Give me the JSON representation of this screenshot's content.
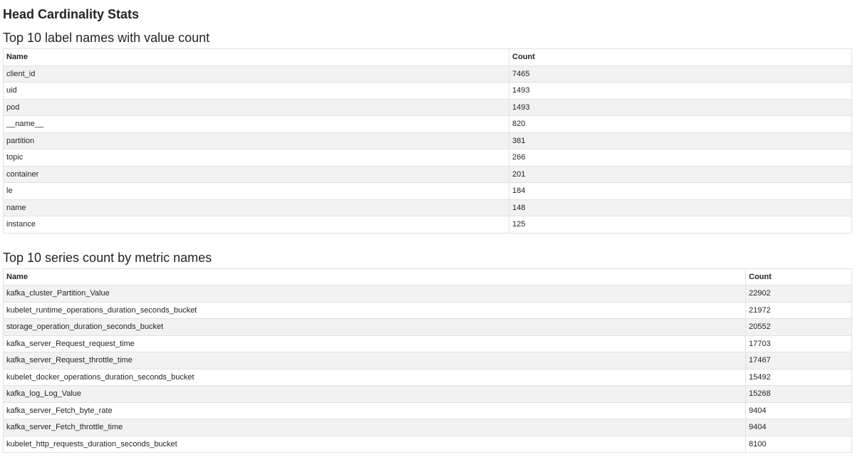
{
  "page": {
    "title": "Head Cardinality Stats"
  },
  "label_names": {
    "heading": "Top 10 label names with value count",
    "columns": [
      "Name",
      "Count"
    ],
    "rows": [
      {
        "name": "client_id",
        "count": "7465"
      },
      {
        "name": "uid",
        "count": "1493"
      },
      {
        "name": "pod",
        "count": "1493"
      },
      {
        "name": "__name__",
        "count": "820"
      },
      {
        "name": "partition",
        "count": "381"
      },
      {
        "name": "topic",
        "count": "266"
      },
      {
        "name": "container",
        "count": "201"
      },
      {
        "name": "le",
        "count": "184"
      },
      {
        "name": "name",
        "count": "148"
      },
      {
        "name": "instance",
        "count": "125"
      }
    ]
  },
  "metric_names": {
    "heading": "Top 10 series count by metric names",
    "columns": [
      "Name",
      "Count"
    ],
    "rows": [
      {
        "name": "kafka_cluster_Partition_Value",
        "count": "22902"
      },
      {
        "name": "kubelet_runtime_operations_duration_seconds_bucket",
        "count": "21972"
      },
      {
        "name": "storage_operation_duration_seconds_bucket",
        "count": "20552"
      },
      {
        "name": "kafka_server_Request_request_time",
        "count": "17703"
      },
      {
        "name": "kafka_server_Request_throttle_time",
        "count": "17467"
      },
      {
        "name": "kubelet_docker_operations_duration_seconds_bucket",
        "count": "15492"
      },
      {
        "name": "kafka_log_Log_Value",
        "count": "15268"
      },
      {
        "name": "kafka_server_Fetch_byte_rate",
        "count": "9404"
      },
      {
        "name": "kafka_server_Fetch_throttle_time",
        "count": "9404"
      },
      {
        "name": "kubelet_http_requests_duration_seconds_bucket",
        "count": "8100"
      }
    ]
  }
}
